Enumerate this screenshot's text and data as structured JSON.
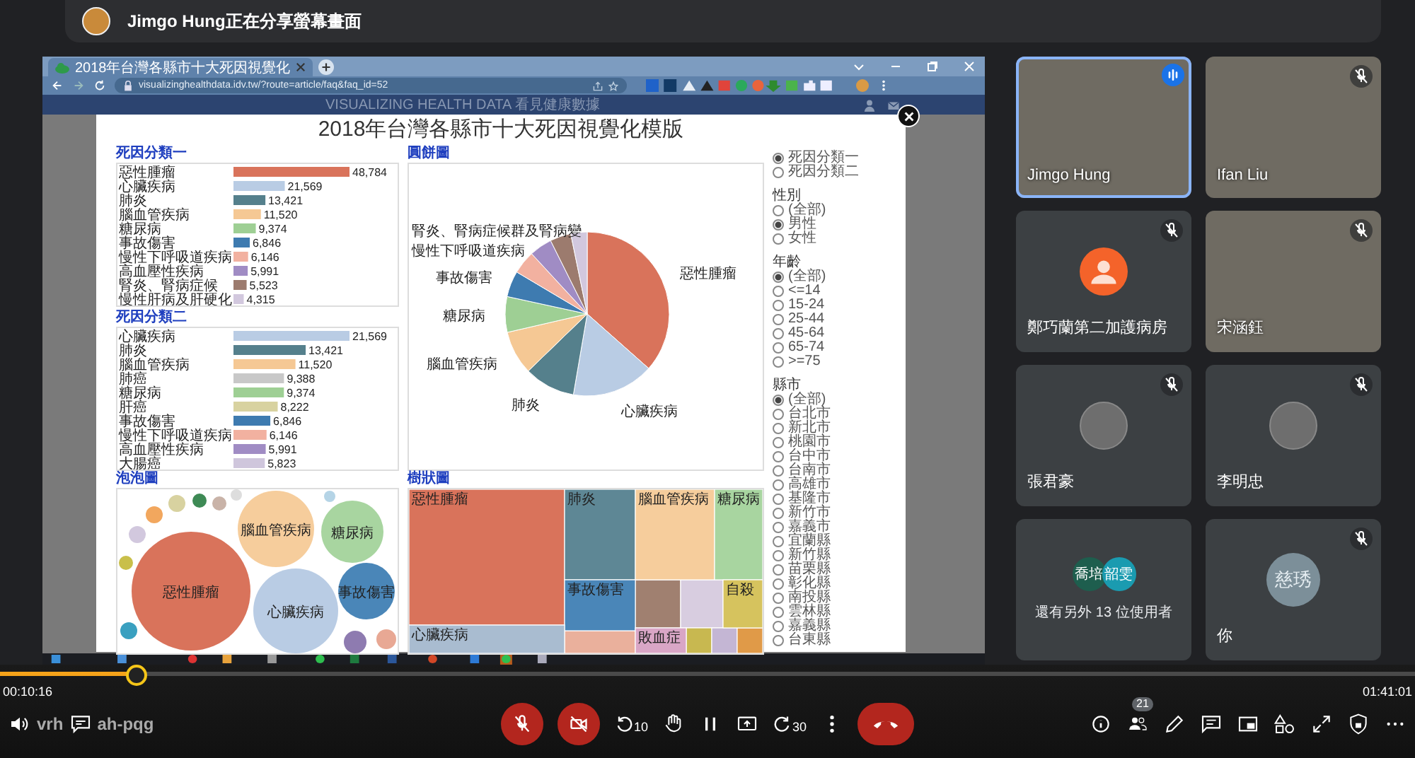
{
  "share_banner": {
    "text": "Jimgo Hung正在分享螢幕畫面"
  },
  "browser": {
    "tab_title": "2018年台灣各縣市十大死因視覺化",
    "url": "visualizinghealthdata.idv.tw/?route=article/faq&faq_id=52",
    "site_header": "VISUALIZING HEALTH DATA 看見健康數據"
  },
  "dashboard": {
    "title": "2018年台灣各縣市十大死因視覺化模版",
    "bar_charts": [
      {
        "title": "死因分類一",
        "chart_data": {
          "type": "bar",
          "orientation": "horizontal",
          "value_labels": [
            "48,784",
            "21,569",
            "13,421",
            "11,520",
            "9,374",
            "6,846",
            "6,146",
            "5,991",
            "5,523",
            "4,315"
          ],
          "categories": [
            "惡性腫瘤",
            "心臟疾病",
            "肺炎",
            "腦血管疾病",
            "糖尿病",
            "事故傷害",
            "慢性下呼吸道疾病",
            "高血壓性疾病",
            "腎炎、腎病症候",
            "慢性肝病及肝硬化"
          ],
          "values": [
            48784,
            21569,
            13421,
            11520,
            9374,
            6846,
            6146,
            5991,
            5523,
            4315
          ],
          "colors": [
            "#d9735b",
            "#b9cce4",
            "#55808c",
            "#f5c894",
            "#9ecf94",
            "#3e7bb0",
            "#f2b1a0",
            "#a08cc4",
            "#9c7b6e",
            "#d2c8de"
          ]
        }
      },
      {
        "title": "死因分類二",
        "chart_data": {
          "type": "bar",
          "orientation": "horizontal",
          "value_labels": [
            "21,569",
            "13,421",
            "11,520",
            "9,388",
            "9,374",
            "8,222",
            "6,846",
            "6,146",
            "5,991",
            "5,823"
          ],
          "categories": [
            "心臟疾病",
            "肺炎",
            "腦血管疾病",
            "肺癌",
            "糖尿病",
            "肝癌",
            "事故傷害",
            "慢性下呼吸道疾病",
            "高血壓性疾病",
            "大腸癌"
          ],
          "values": [
            21569,
            13421,
            11520,
            9388,
            9374,
            8222,
            6846,
            6146,
            5991,
            5823
          ],
          "colors": [
            "#b9cce4",
            "#55808c",
            "#f5c894",
            "#c8c8c8",
            "#9ecf94",
            "#d8d2a0",
            "#3e7bb0",
            "#f2b1a0",
            "#a08cc4",
            "#cfc6dc"
          ]
        }
      }
    ],
    "pie": {
      "title": "圓餅圖",
      "labels": [
        "腎炎、腎病症候群及腎病變",
        "慢性下呼吸道疾病",
        "事故傷害",
        "惡性腫瘤",
        "糖尿病",
        "腦血管疾病",
        "肺炎",
        "心臟疾病"
      ]
    },
    "bubble": {
      "title": "泡泡圖",
      "bubbles": [
        {
          "label": "惡性腫瘤",
          "color": "#d9735b"
        },
        {
          "label": "心臟疾病",
          "color": "#b9cce4"
        },
        {
          "label": "腦血管疾病",
          "color": "#f6cd9c"
        },
        {
          "label": "糖尿病",
          "color": "#a8d5a0"
        },
        {
          "label": "事故傷害",
          "color": "#4a86b8"
        }
      ]
    },
    "treemap": {
      "title": "樹狀圖",
      "cells": [
        {
          "label": "惡性腫瘤",
          "color": "#d9735b"
        },
        {
          "label": "肺炎",
          "color": "#5e8795"
        },
        {
          "label": "腦血管疾病",
          "color": "#f6cd9c"
        },
        {
          "label": "糖尿病",
          "color": "#a8d5a0"
        },
        {
          "label": "事故傷害",
          "color": "#4a86b8"
        },
        {
          "label": "自殺",
          "color": "#d6c35e"
        },
        {
          "label": "心臟疾病",
          "color": "#a9bcd0"
        },
        {
          "label": "敗血症",
          "color": "#d9a6c6"
        }
      ]
    },
    "filters": [
      {
        "options": [
          {
            "label": "死因分類一",
            "selected": true
          },
          {
            "label": "死因分類二",
            "selected": false
          }
        ]
      },
      {
        "title": "性別",
        "options": [
          {
            "label": "(全部)",
            "selected": false
          },
          {
            "label": "男性",
            "selected": true
          },
          {
            "label": "女性",
            "selected": false
          }
        ]
      },
      {
        "title": "年齡",
        "options": [
          {
            "label": "(全部)",
            "selected": true
          },
          {
            "label": "<=14",
            "selected": false
          },
          {
            "label": "15-24",
            "selected": false
          },
          {
            "label": "25-44",
            "selected": false
          },
          {
            "label": "45-64",
            "selected": false
          },
          {
            "label": "65-74",
            "selected": false
          },
          {
            "label": ">=75",
            "selected": false
          }
        ]
      },
      {
        "title": "縣市",
        "options": [
          {
            "label": "(全部)",
            "selected": true
          },
          {
            "label": "台北市",
            "selected": false
          },
          {
            "label": "新北市",
            "selected": false
          },
          {
            "label": "桃園市",
            "selected": false
          },
          {
            "label": "台中市",
            "selected": false
          },
          {
            "label": "台南市",
            "selected": false
          },
          {
            "label": "高雄市",
            "selected": false
          },
          {
            "label": "基隆市",
            "selected": false
          },
          {
            "label": "新竹市",
            "selected": false
          },
          {
            "label": "嘉義市",
            "selected": false
          },
          {
            "label": "宜蘭縣",
            "selected": false
          },
          {
            "label": "新竹縣",
            "selected": false
          },
          {
            "label": "苗栗縣",
            "selected": false
          },
          {
            "label": "彰化縣",
            "selected": false
          },
          {
            "label": "南投縣",
            "selected": false
          },
          {
            "label": "雲林縣",
            "selected": false
          },
          {
            "label": "嘉義縣",
            "selected": false
          },
          {
            "label": "台東縣",
            "selected": false
          }
        ]
      }
    ]
  },
  "participants": [
    {
      "name": "Jimgo Hung",
      "kind": "video",
      "speaking": true,
      "muted": false
    },
    {
      "name": "Ifan Liu",
      "kind": "video",
      "speaking": false,
      "muted": true
    },
    {
      "name": "鄭巧蘭第二加護病房",
      "kind": "avatar",
      "color": "#f4632a",
      "speaking": false,
      "muted": true
    },
    {
      "name": "宋涵鈺",
      "kind": "video",
      "speaking": false,
      "muted": true
    },
    {
      "name": "張君豪",
      "kind": "photo",
      "speaking": false,
      "muted": true
    },
    {
      "name": "李明忠",
      "kind": "photo",
      "speaking": false,
      "muted": true
    },
    {
      "name": "還有另外 13 位使用者",
      "kind": "overflow",
      "speaking": false,
      "muted": false,
      "others": [
        {
          "initials": "喬培",
          "color": "#1e5e4e"
        },
        {
          "initials": "韶雯",
          "color": "#1a9bb0"
        }
      ]
    },
    {
      "name": "你",
      "kind": "initials",
      "initials": "慈琇",
      "color": "#7c8f99",
      "speaking": false,
      "muted": true
    }
  ],
  "player": {
    "level": 0.096,
    "elapsed": "00:10:16",
    "total": "01:41:01",
    "meeting_code": [
      "vrh",
      "ah-pqg"
    ],
    "mic_on": false,
    "camera_on": false,
    "skip_back": "10",
    "skip_forward": "30",
    "people_count": "21"
  }
}
